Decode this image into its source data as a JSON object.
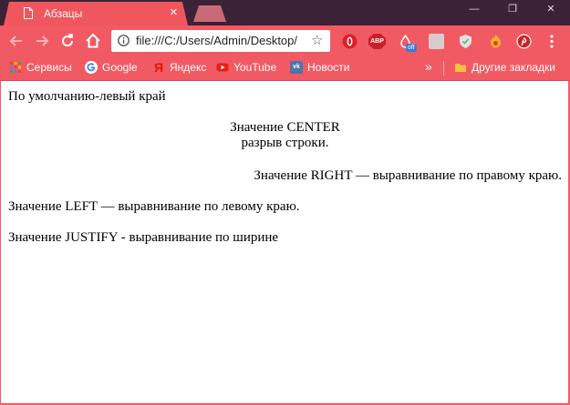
{
  "tab": {
    "title": "Абзацы",
    "close": "×"
  },
  "window": {
    "minimize": "—",
    "maximize": "❐",
    "close": "✕"
  },
  "address": {
    "url": "file:///C:/Users/Admin/Desktop/"
  },
  "extensions": {
    "abp": "ABP",
    "off": "off"
  },
  "bookmarks": {
    "items": [
      "Сервисы",
      "Google",
      "Яндекс",
      "YouTube",
      "Новости"
    ],
    "more": "»",
    "other": "Другие закладки"
  },
  "content": {
    "p1": "По умолчанию-левый край",
    "p2_line1": "Значение CENTER",
    "p2_line2": "разрыв строки.",
    "p3": "Значение RIGHT — выравнивание по правому краю.",
    "p4": "Значение LEFT — выравнивание по левому краю.",
    "p5": "Значение JUSTIFY - выравнивание по ширине"
  },
  "colors": {
    "chrome": "#f25a63",
    "titlebar": "#3b2236"
  }
}
